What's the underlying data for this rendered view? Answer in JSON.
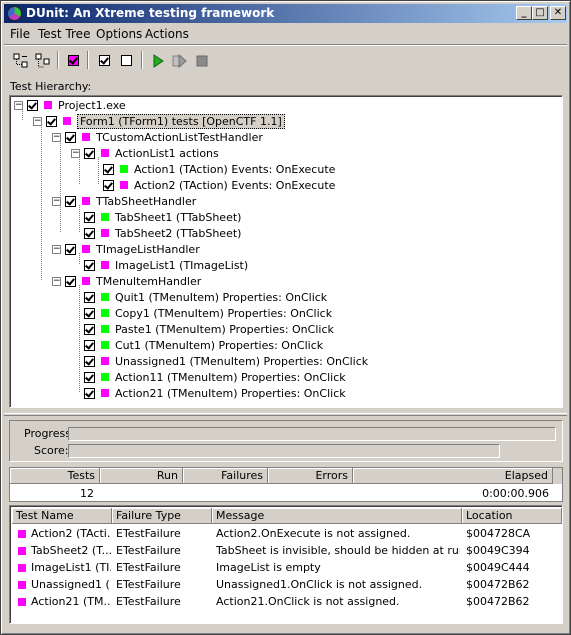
{
  "window": {
    "title": "DUnit: An Xtreme testing framework"
  },
  "title_buttons": {
    "minimize": "_",
    "maximize": "□",
    "close": "✕"
  },
  "menu": [
    "File",
    "Test Tree",
    "Options",
    "Actions"
  ],
  "toolbar": {
    "icons": [
      "select-all-icon",
      "deselect-all-icon",
      "select-current-icon",
      "check-icon",
      "uncheck-icon",
      "run-icon",
      "run-selected-icon",
      "stop-icon"
    ]
  },
  "hierarchy_label": "Test Hierarchy:",
  "tree": [
    {
      "label": "Project1.exe",
      "color": "magenta",
      "checked": true
    },
    {
      "label": "Form1 (TForm1) tests [OpenCTF 1.1]",
      "color": "magenta",
      "checked": true
    },
    {
      "label": "TCustomActionListTestHandler",
      "color": "magenta",
      "checked": true
    },
    {
      "label": "ActionList1 actions",
      "color": "magenta",
      "checked": true
    },
    {
      "label": "Action1 (TAction) Events: OnExecute",
      "color": "green",
      "checked": true
    },
    {
      "label": "Action2 (TAction) Events: OnExecute",
      "color": "magenta",
      "checked": true
    },
    {
      "label": "TTabSheetHandler",
      "color": "magenta",
      "checked": true
    },
    {
      "label": "TabSheet1 (TTabSheet)",
      "color": "green",
      "checked": true
    },
    {
      "label": "TabSheet2 (TTabSheet)",
      "color": "magenta",
      "checked": true
    },
    {
      "label": "TImageListHandler",
      "color": "magenta",
      "checked": true
    },
    {
      "label": "ImageList1 (TImageList)",
      "color": "magenta",
      "checked": true
    },
    {
      "label": "TMenuItemHandler",
      "color": "magenta",
      "checked": true
    },
    {
      "label": "Quit1 (TMenuItem) Properties: OnClick",
      "color": "green",
      "checked": true
    },
    {
      "label": "Copy1 (TMenuItem) Properties: OnClick",
      "color": "green",
      "checked": true
    },
    {
      "label": "Paste1 (TMenuItem) Properties: OnClick",
      "color": "green",
      "checked": true
    },
    {
      "label": "Cut1 (TMenuItem) Properties: OnClick",
      "color": "green",
      "checked": true
    },
    {
      "label": "Unassigned1 (TMenuItem) Properties: OnClick",
      "color": "magenta",
      "checked": true
    },
    {
      "label": "Action11 (TMenuItem) Properties: OnClick",
      "color": "green",
      "checked": true
    },
    {
      "label": "Action21 (TMenuItem) Properties: OnClick",
      "color": "magenta",
      "checked": true
    }
  ],
  "progress": {
    "progress_label": "Progress:",
    "score_label": "Score:"
  },
  "stats": {
    "headers": [
      "Tests",
      "Run",
      "Failures",
      "Errors",
      "Elapsed"
    ],
    "values": {
      "tests": "12",
      "elapsed": "0:00:00.906"
    }
  },
  "failures": {
    "headers": [
      "Test Name",
      "Failure Type",
      "Message",
      "Location"
    ],
    "rows": [
      {
        "name": "Action2 (TActi...",
        "type": "ETestFailure",
        "message": "Action2.OnExecute is not assigned.",
        "location": "$004728CA"
      },
      {
        "name": "TabSheet2 (T...",
        "type": "ETestFailure",
        "message": "TabSheet is invisible, should be hidden at run time",
        "location": "$0049C394"
      },
      {
        "name": "ImageList1 (TI...",
        "type": "ETestFailure",
        "message": "ImageList is empty",
        "location": "$0049C444"
      },
      {
        "name": "Unassigned1 (...",
        "type": "ETestFailure",
        "message": "Unassigned1.OnClick is not assigned.",
        "location": "$00472B62"
      },
      {
        "name": "Action21 (TM...",
        "type": "ETestFailure",
        "message": "Action21.OnClick is not assigned.",
        "location": "$00472B62"
      }
    ]
  },
  "colors": {
    "magenta": "#ff00ff",
    "green": "#00ff00",
    "titlebar": "#0a246a"
  }
}
